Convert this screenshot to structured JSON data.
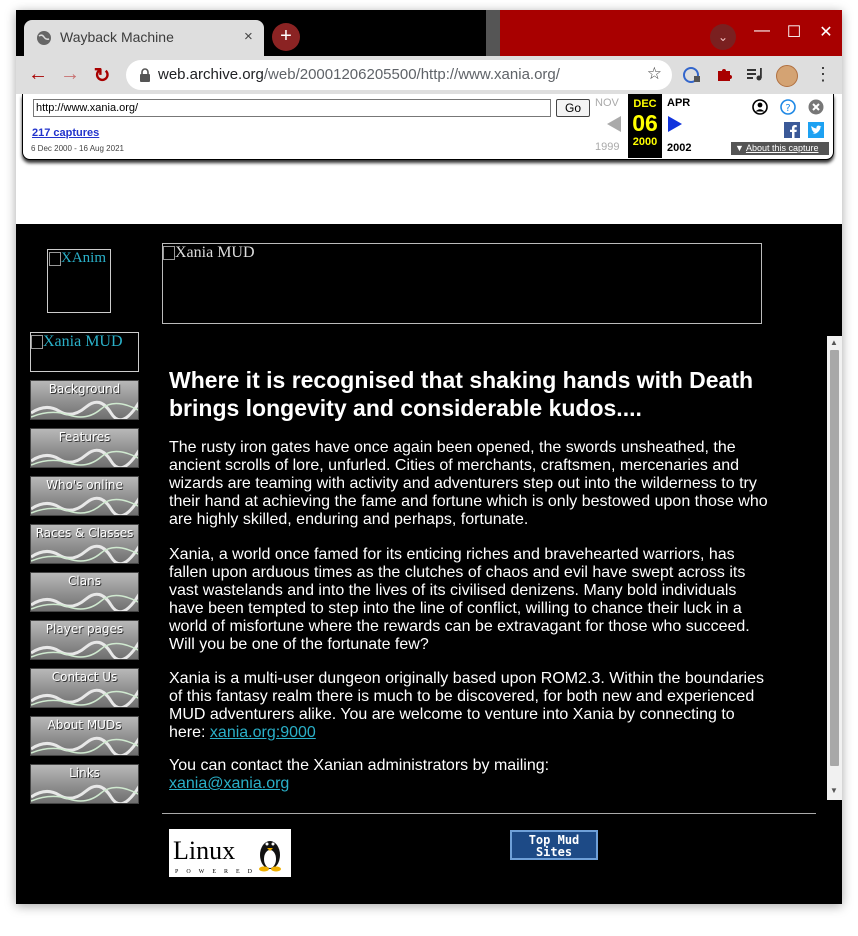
{
  "browser": {
    "tab_title": "Wayback Machine",
    "tab_close": "×",
    "new_tab": "+",
    "url_host": "web.archive.org",
    "url_path": "/web/20001206205500/http://www.xania.org/",
    "back": "←",
    "forward": "→",
    "reload": "↻",
    "star": "☆",
    "minimize": "—",
    "maximize": "☐",
    "close": "✕",
    "menu": "⋮",
    "tab_search": "⌄",
    "accent_color": "#a80000"
  },
  "wayback": {
    "url_value": "http://www.xania.org/",
    "go_label": "Go",
    "captures_label": "217 captures",
    "date_range": "6 Dec 2000 - 16 Aug 2021",
    "prev_month": "NOV",
    "prev_year": "1999",
    "current_month": "DEC",
    "current_day": "06",
    "current_year": "2000",
    "next_month": "APR",
    "next_year": "2002",
    "about_label": "About this capture",
    "about_arrow": "▼"
  },
  "site": {
    "xanim_alt": "XAnim",
    "banner_alt": "Xania MUD",
    "logo_alt": "Xania MUD",
    "nav": [
      "Background",
      "Features",
      "Who's online",
      "Races & Classes",
      "Clans",
      "Player pages",
      "Contact Us",
      "About MUDs",
      "Links"
    ],
    "headline": "Where it is recognised that shaking hands with Death brings longevity and considerable kudos....",
    "para1": "The rusty iron gates have once again been opened, the swords unsheathed, the ancient scrolls of lore, unfurled. Cities of merchants, craftsmen, mercenaries and wizards are teaming with activity and adventurers step out into the wilderness to try their hand at achieving the fame and fortune which is only bestowed upon those who are highly skilled, enduring and perhaps, fortunate.",
    "para2": "Xania, a world once famed for its enticing riches and bravehearted warriors, has fallen upon arduous times as the clutches of chaos and evil have swept across its vast wastelands and into the lives of its civilised denizens. Many bold individuals have been tempted to step into the line of conflict, willing to chance their luck in a world of misfortune where the rewards can be extravagant for those who succeed. Will you be one of the fortunate few?",
    "para3_text": "Xania is a multi-user dungeon originally based upon ROM2.3. Within the boundaries of this fantasy realm there is much to be discovered, for both new and experienced MUD adventurers alike. You are welcome to venture into Xania by connecting to here: ",
    "para3_link": "xania.org:9000",
    "para4_text": "You can contact the Xanian administrators by mailing:",
    "para4_link": "xania@xania.org",
    "linux_text": "Linux",
    "linux_sub": "POWERED",
    "topmud_line1": "Top Mud",
    "topmud_line2": "Sites",
    "link_color": "#2ab0c8"
  }
}
